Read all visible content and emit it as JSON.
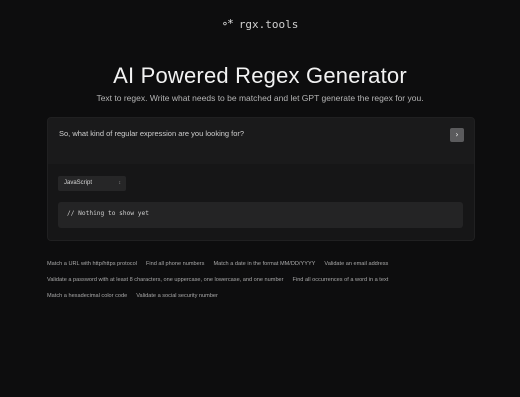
{
  "brand": {
    "icon": "∘*",
    "name": "rgx.tools"
  },
  "hero": {
    "title": "AI Powered Regex Generator",
    "subtitle": "Text to regex. Write what needs to be matched and let GPT generate the regex for you."
  },
  "prompt": {
    "placeholder": "So, what kind of regular expression are you looking for?",
    "submit_icon": "chevron-right-icon",
    "submit_glyph": "›"
  },
  "language": {
    "selected": "JavaScript",
    "chevron": "↕"
  },
  "output": {
    "text": "// Nothing to show yet"
  },
  "examples": [
    "Match a URL with http/https protocol",
    "Find all phone numbers",
    "Match a date in the format MM/DD/YYYY",
    "Validate an email address",
    "Validate a password with at least 8 characters, one uppercase, one lowercase, and one number",
    "Find all occurrences of a word in a text",
    "Match a hexadecimal color code",
    "Validate a social security number"
  ]
}
